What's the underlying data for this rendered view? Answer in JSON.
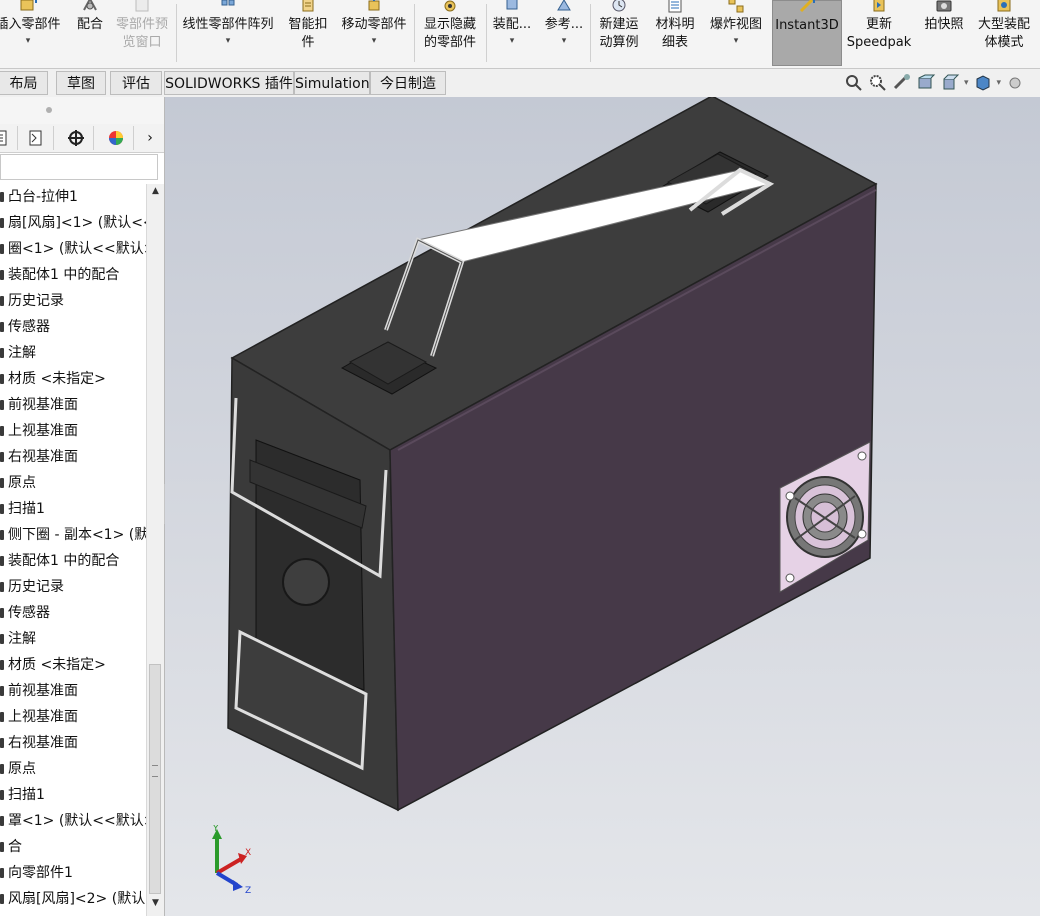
{
  "ribbon": {
    "buttons": [
      {
        "label": "插入零部件",
        "has_arrow": true,
        "icon": "insert-component-icon"
      },
      {
        "label": "配合",
        "has_arrow": false,
        "icon": "mate-icon"
      },
      {
        "label": "零部件预\n览窗口",
        "has_arrow": false,
        "icon": "preview-window-icon",
        "disabled": true
      },
      {
        "label": "线性零部件阵列",
        "has_arrow": true,
        "icon": "linear-pattern-icon"
      },
      {
        "label": "智能扣\n件",
        "has_arrow": false,
        "icon": "smart-fastener-icon"
      },
      {
        "label": "移动零部件",
        "has_arrow": true,
        "icon": "move-component-icon"
      },
      {
        "label": "显示隐藏\n的零部件",
        "has_arrow": false,
        "icon": "show-hidden-icon"
      },
      {
        "label": "装配...",
        "has_arrow": true,
        "icon": "assembly-features-icon"
      },
      {
        "label": "参考...",
        "has_arrow": true,
        "icon": "reference-geometry-icon"
      },
      {
        "label": "新建运\n动算例",
        "has_arrow": false,
        "icon": "motion-study-icon"
      },
      {
        "label": "材料明\n细表",
        "has_arrow": false,
        "icon": "bom-icon"
      },
      {
        "label": "爆炸视图",
        "has_arrow": true,
        "icon": "exploded-view-icon"
      },
      {
        "label": "Instant3D",
        "has_arrow": false,
        "icon": "instant3d-icon",
        "active": true
      },
      {
        "label": "更新\nSpeedpak",
        "has_arrow": false,
        "icon": "speedpak-icon"
      },
      {
        "label": "拍快照",
        "has_arrow": false,
        "icon": "snapshot-icon"
      },
      {
        "label": "大型装配\n体模式",
        "has_arrow": false,
        "icon": "large-assembly-icon"
      }
    ]
  },
  "tabs": [
    "布局",
    "草图",
    "评估",
    "SOLIDWORKS 插件",
    "Simulation",
    "今日制造"
  ],
  "feature_tree": {
    "items": [
      "凸台-拉伸1",
      "扇[风扇]<1> (默认<<",
      "圈<1> (默认<<默认>",
      "装配体1 中的配合",
      "历史记录",
      "传感器",
      "注解",
      "材质 <未指定>",
      "前视基准面",
      "上视基准面",
      "右视基准面",
      "原点",
      "扫描1",
      "侧下圈 - 副本<1> (默",
      "装配体1 中的配合",
      "历史记录",
      "传感器",
      "注解",
      "材质 <未指定>",
      "前视基准面",
      "上视基准面",
      "右视基准面",
      "原点",
      "扫描1",
      "罩<1> (默认<<默认>",
      "合",
      "向零部件1",
      "风扇[风扇]<2> (默认"
    ]
  },
  "panel_tabs": [
    "feature-manager-icon",
    "property-manager-icon",
    "configuration-manager-icon",
    "appearance-icon"
  ],
  "triad": {
    "x": "X",
    "y": "Y",
    "z": "Z"
  },
  "colors": {
    "ribbon_bg": "#f4f4f4",
    "active_button": "#a9a9a9",
    "viewport_top": "#c4c9d4",
    "box_front": "#463948",
    "box_side": "#333333",
    "box_top": "#3b3b3b",
    "fan_grille": "#e8d4e8"
  }
}
